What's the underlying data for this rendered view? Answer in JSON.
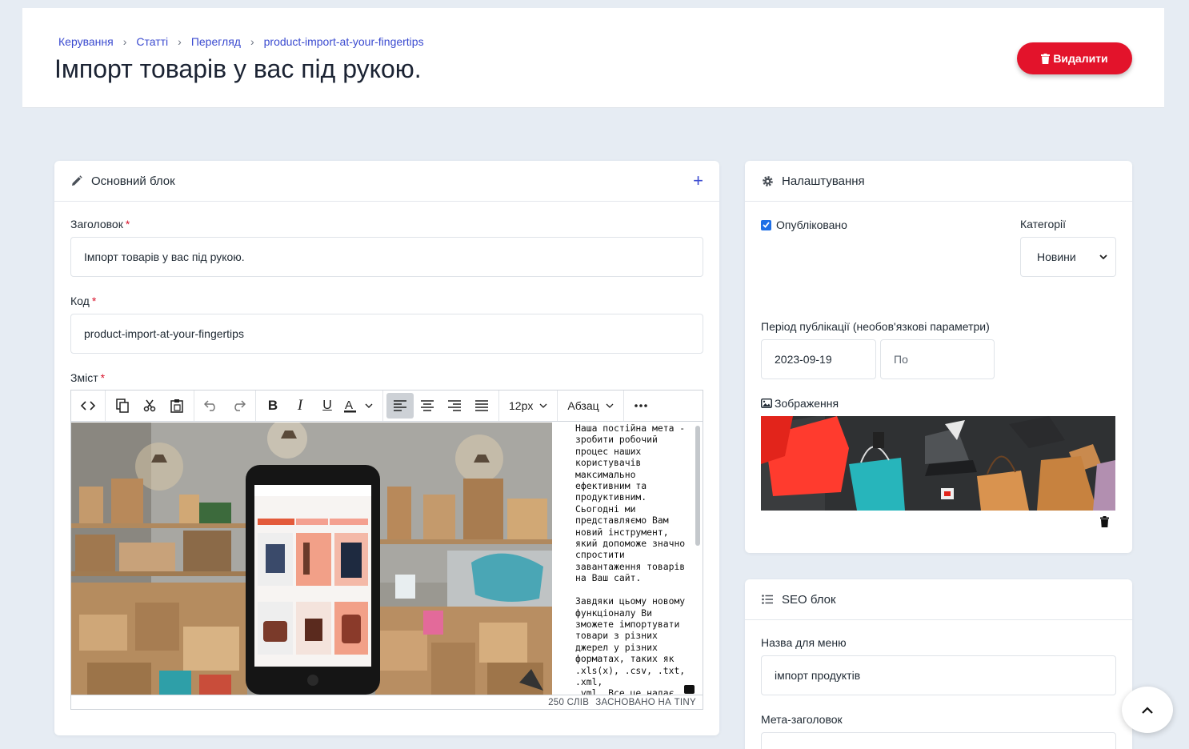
{
  "breadcrumb": [
    "Керування",
    "Статті",
    "Перегляд",
    "product-import-at-your-fingertips"
  ],
  "page_title": "Імпорт товарів у вас під рукою.",
  "delete_label": "Видалити",
  "main_block": {
    "title": "Основний блок",
    "title_label": "Заголовок",
    "title_value": "Імпорт товарів у вас під рукою.",
    "code_label": "Код",
    "code_value": "product-import-at-your-fingertips",
    "content_label": "Зміст",
    "font_size": "12px",
    "block_format": "Абзац",
    "text": "Наша постійна мета -\nзробити робочий\nпроцес наших\nкористувачів\nмаксимально\nефективним та\nпродуктивним.\nСьогодні ми\nпредставляємо Вам\nновий інструмент,\nякий допоможе значно\nспростити\nзавантаження товарів\nна Ваш сайт.\n\nЗавдяки цьому новому\nфункціоналу Ви\nзможете імпортувати\nтовари з різних\nджерел у різних\nформатах, таких як\n.xls(x), .csv, .txt, .xml,\n.yml. Все це надає\nВам величезну",
    "word_count": "250 СЛІВ",
    "powered": "ЗАСНОВАНО НА TINY"
  },
  "settings": {
    "title": "Налаштування",
    "published_label": "Опубліковано",
    "categories_label": "Категорії",
    "category_value": "Новини",
    "period_label": "Період публікації (необов'язкові параметри)",
    "date_from": "2023-09-19",
    "date_to_placeholder": "По",
    "image_label": "Зображення"
  },
  "seo": {
    "title": "SEO блок",
    "menu_name_label": "Назва для меню",
    "menu_name_value": "імпорт продуктів",
    "meta_title_label": "Мета-заголовок"
  },
  "colors": {
    "accent": "#3b4bd0",
    "danger": "#e3132b",
    "checkbox": "#1f6fe6"
  }
}
